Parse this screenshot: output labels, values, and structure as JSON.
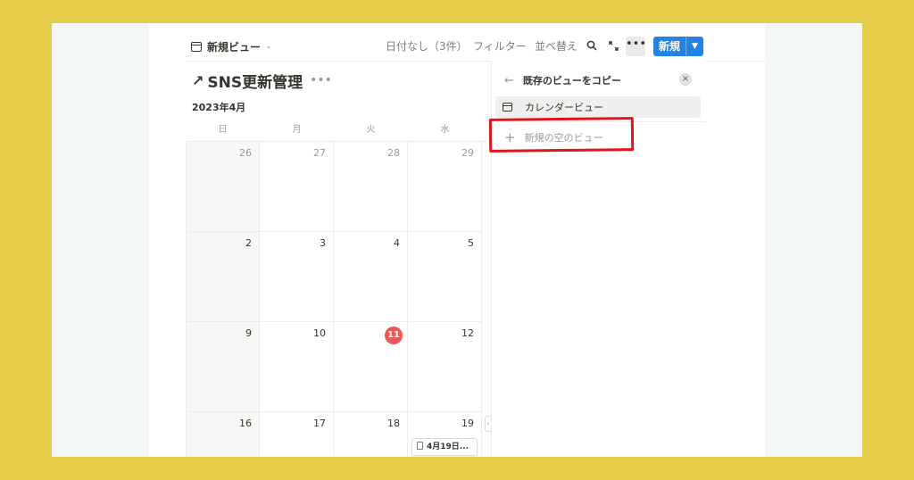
{
  "toolbar": {
    "view_label": "新規ビュー",
    "undated": "日付なし（3件）",
    "filter": "フィルター",
    "sort": "並べ替え",
    "search_icon": "search-icon",
    "expand_icon": "expand-icon",
    "more": "•••",
    "new_button": "新規"
  },
  "page": {
    "title": "SNS更新管理",
    "month": "2023年4月"
  },
  "calendar": {
    "weekdays": [
      "日",
      "月",
      "火",
      "水"
    ],
    "weeks": [
      [
        "26",
        "27",
        "28",
        "29"
      ],
      [
        "2",
        "3",
        "4",
        "5"
      ],
      [
        "9",
        "10",
        "11",
        "12"
      ],
      [
        "16",
        "17",
        "18",
        "19"
      ]
    ],
    "today": "11",
    "event_label": "4月19日..."
  },
  "panel": {
    "title": "既存のビューをコピー",
    "existing_view": "カレンダービュー",
    "new_empty_view": "新規の空のビュー"
  },
  "colors": {
    "accent": "#2383e2",
    "today": "#eb5757",
    "highlight": "#e0151b",
    "background": "#e5cd49"
  }
}
